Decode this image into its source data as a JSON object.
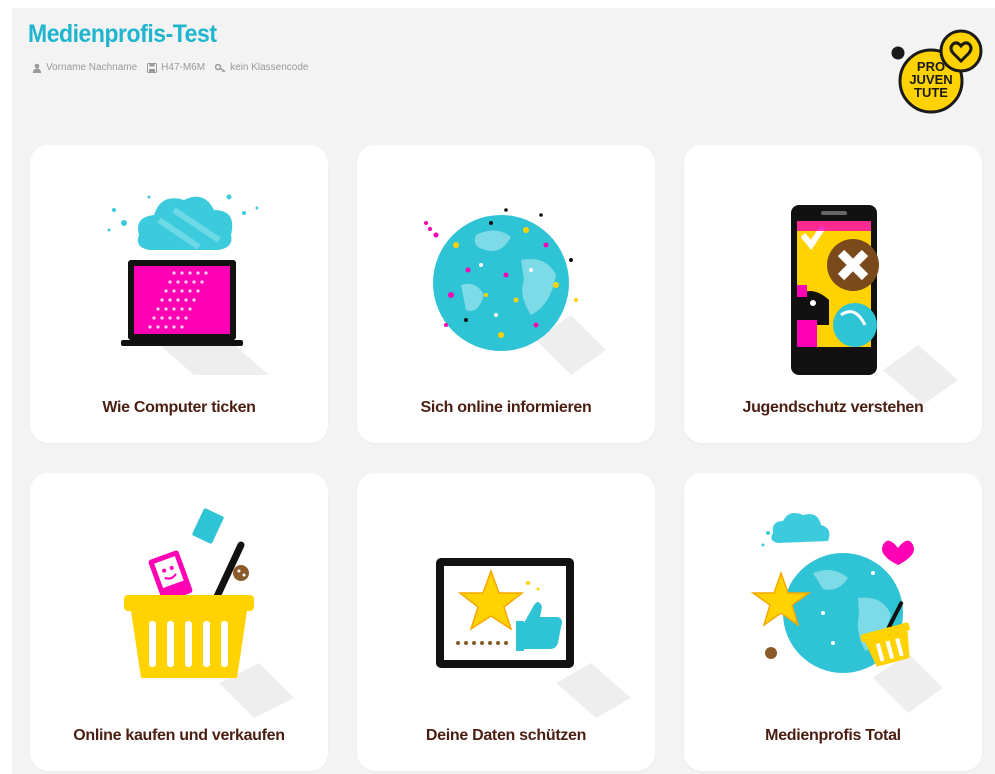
{
  "header": {
    "title": "Medienprofis-Test",
    "user_name": "Vorname Nachname",
    "code": "H47-M6M",
    "class_code": "kein Klassencode",
    "logo_text": [
      "PRO",
      "JUVEN",
      "TUTE"
    ]
  },
  "cards": [
    {
      "label": "Wie Computer ticken",
      "icon": "laptop-cloud-icon"
    },
    {
      "label": "Sich online informieren",
      "icon": "globe-icon"
    },
    {
      "label": "Jugendschutz verstehen",
      "icon": "smartphone-icon"
    },
    {
      "label": "Online kaufen und verkaufen",
      "icon": "shopping-basket-icon"
    },
    {
      "label": "Deine Daten schützen",
      "icon": "tablet-thumbs-up-icon"
    },
    {
      "label": "Medienprofis Total",
      "icon": "globe-star-heart-icon"
    }
  ],
  "colors": {
    "title": "#1fb5cf",
    "label": "#4a1f12",
    "cyan": "#2fc3d6",
    "magenta": "#ff00b4",
    "yellow": "#ffd200",
    "background": "#f3f3f3"
  }
}
